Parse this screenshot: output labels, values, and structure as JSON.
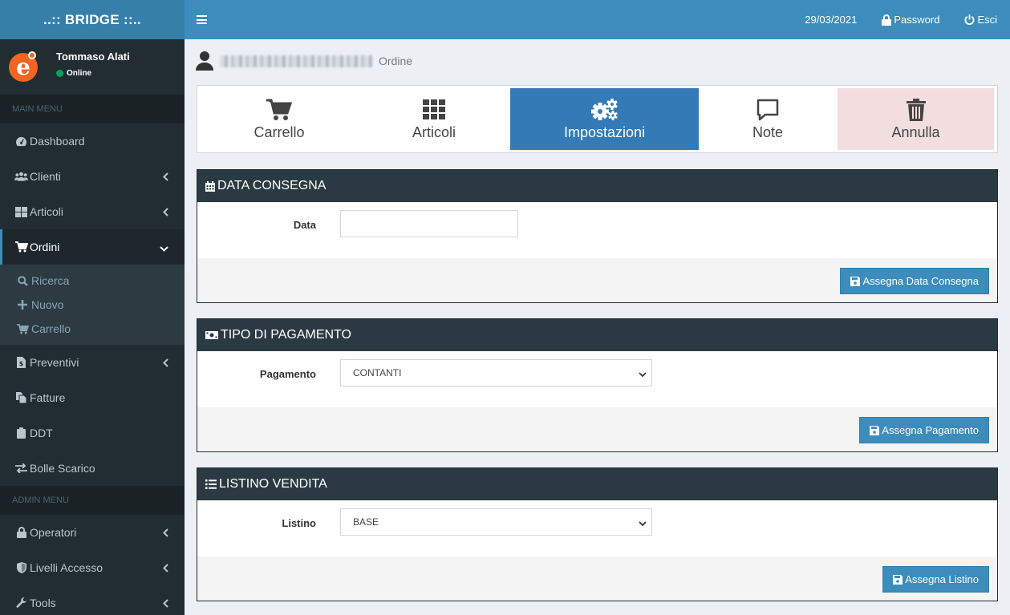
{
  "app": {
    "logo": "..:: BRIDGE ::.."
  },
  "user": {
    "name": "Tommaso Alati",
    "status": "Online"
  },
  "sidebar": {
    "main_header": "MAIN MENU",
    "admin_header": "ADMIN MENU",
    "items": [
      {
        "label": "Dashboard",
        "icon": "dashboard-icon"
      },
      {
        "label": "Clienti",
        "icon": "users-icon"
      },
      {
        "label": "Articoli",
        "icon": "grid-icon"
      },
      {
        "label": "Ordini",
        "icon": "cart-icon"
      },
      {
        "label": "Preventivi",
        "icon": "file-dollar-icon"
      },
      {
        "label": "Fatture",
        "icon": "copy-icon"
      },
      {
        "label": "DDT",
        "icon": "clipboard-icon"
      },
      {
        "label": "Bolle Scarico",
        "icon": "exchange-icon"
      }
    ],
    "ordini_sub": [
      {
        "label": "Ricerca",
        "icon": "search-icon"
      },
      {
        "label": "Nuovo",
        "icon": "plus-icon"
      },
      {
        "label": "Carrello",
        "icon": "cart-icon"
      }
    ],
    "admin_items": [
      {
        "label": "Operatori",
        "icon": "lock-icon"
      },
      {
        "label": "Livelli Accesso",
        "icon": "shield-icon"
      },
      {
        "label": "Tools",
        "icon": "wrench-icon"
      }
    ]
  },
  "navbar": {
    "date": "29/03/2021",
    "password": "Password",
    "logout": "Esci"
  },
  "page": {
    "subtitle": "Ordine"
  },
  "tabs": [
    {
      "label": "Carrello",
      "icon": "cart-icon"
    },
    {
      "label": "Articoli",
      "icon": "grid-icon"
    },
    {
      "label": "Impostazioni",
      "icon": "cogs-icon"
    },
    {
      "label": "Note",
      "icon": "comment-icon"
    },
    {
      "label": "Annulla",
      "icon": "trash-icon"
    }
  ],
  "sections": {
    "consegna": {
      "title": "DATA CONSEGNA",
      "label": "Data",
      "value": "",
      "button": "Assegna Data Consegna"
    },
    "pagamento": {
      "title": "TIPO DI PAGAMENTO",
      "label": "Pagamento",
      "value": "CONTANTI",
      "button": "Assegna Pagamento"
    },
    "listino": {
      "title": "LISTINO VENDITA",
      "label": "Listino",
      "value": "BASE",
      "button": "Assegna Listino"
    }
  },
  "colors": {
    "navbar": "#3c8dbc",
    "logo_bg": "#367fa9",
    "sidebar": "#222d32",
    "active_tab": "#337ab7",
    "danger_tab": "#f2dede",
    "status_online": "#00a65a"
  }
}
